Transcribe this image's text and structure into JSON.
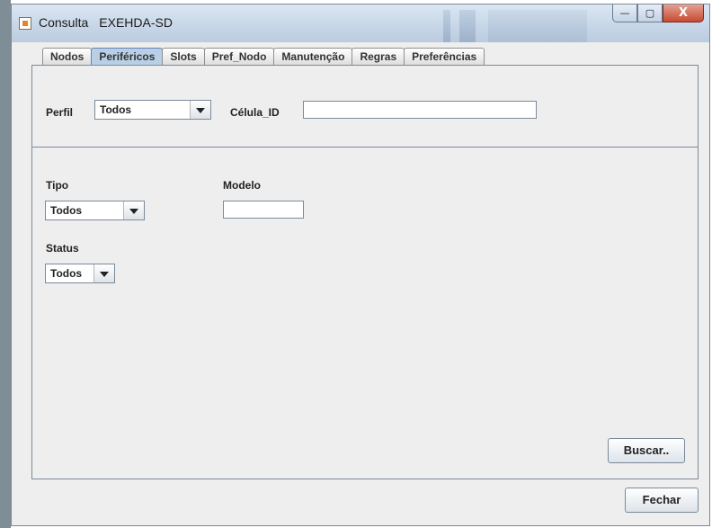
{
  "window": {
    "title_parts": [
      "Consulta",
      "EXEHDA-SD"
    ],
    "controls": {
      "minimize": "—",
      "maximize": "▢",
      "close": "X"
    }
  },
  "tabs": [
    {
      "label": "Nodos",
      "active": false
    },
    {
      "label": "Periféricos",
      "active": true
    },
    {
      "label": "Slots",
      "active": false
    },
    {
      "label": "Pref_Nodo",
      "active": false
    },
    {
      "label": "Manutenção",
      "active": false
    },
    {
      "label": "Regras",
      "active": false
    },
    {
      "label": "Preferências",
      "active": false
    }
  ],
  "form": {
    "perfil_label": "Perfil",
    "perfil_value": "Todos",
    "celula_label": "Célula_ID",
    "celula_value": "",
    "tipo_label": "Tipo",
    "tipo_value": "Todos",
    "modelo_label": "Modelo",
    "modelo_value": "",
    "status_label": "Status",
    "status_value": "Todos"
  },
  "buttons": {
    "buscar": "Buscar..",
    "fechar": "Fechar"
  },
  "colors": {
    "active_tab": "#b8cfe5",
    "titlebar": "#c6d6e7",
    "close_button": "#c64a33"
  }
}
